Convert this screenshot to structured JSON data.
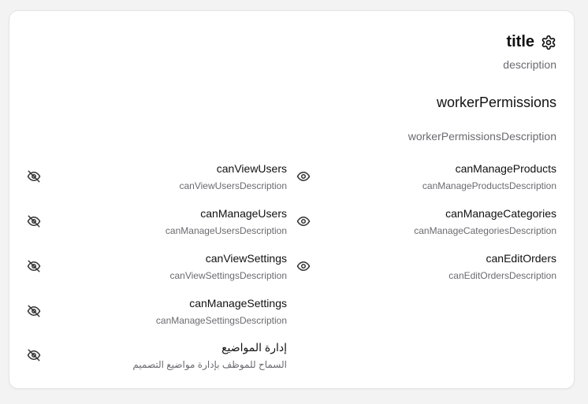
{
  "header": {
    "title": "title",
    "description": "description",
    "icon": "gear-icon"
  },
  "section": {
    "title": "workerPermissions",
    "description": "workerPermissionsDescription"
  },
  "permissions_right": [
    {
      "label": "canManageProducts",
      "description": "canManageProductsDescription",
      "icon": "eye-icon"
    },
    {
      "label": "canManageCategories",
      "description": "canManageCategoriesDescription",
      "icon": "eye-icon"
    },
    {
      "label": "canEditOrders",
      "description": "canEditOrdersDescription",
      "icon": "eye-icon"
    }
  ],
  "permissions_left": [
    {
      "label": "canViewUsers",
      "description": "canViewUsersDescription",
      "icon": "eye-off-icon"
    },
    {
      "label": "canManageUsers",
      "description": "canManageUsersDescription",
      "icon": "eye-off-icon"
    },
    {
      "label": "canViewSettings",
      "description": "canViewSettingsDescription",
      "icon": "eye-off-icon"
    },
    {
      "label": "canManageSettings",
      "description": "canManageSettingsDescription",
      "icon": "eye-off-icon"
    },
    {
      "label": "إدارة المواضيع",
      "description": "السماح للموظف بإدارة مواضيع التصميم",
      "icon": "eye-off-icon"
    }
  ],
  "colors": {
    "text": "#111111",
    "muted": "#6b6b70",
    "border": "#e4e4e7",
    "icon": "#333333"
  }
}
